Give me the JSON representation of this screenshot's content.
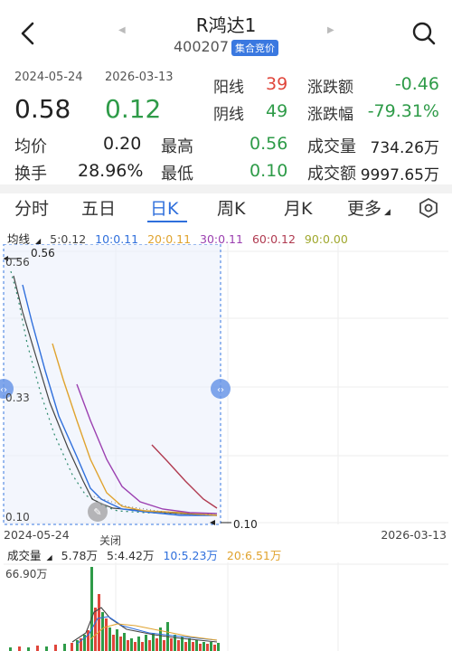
{
  "header": {
    "title": "R鸿达1",
    "code": "400207",
    "badge": "集合竞价"
  },
  "summary": {
    "start_date": "2024-05-24",
    "end_date": "2026-03-13",
    "start_price": "0.58",
    "end_price": "0.12",
    "up_days_label": "阳线",
    "up_days": "39",
    "down_days_label": "阴线",
    "down_days": "49",
    "change_amount_label": "涨跌额",
    "change_amount": "-0.46",
    "change_pct_label": "涨跌幅",
    "change_pct": "-79.31%",
    "avg_label": "均价",
    "avg": "0.20",
    "high_label": "最高",
    "high": "0.56",
    "volume_label": "成交量",
    "volume": "734.26万",
    "turnover_label": "换手",
    "turnover": "28.96%",
    "low_label": "最低",
    "low": "0.10",
    "amount_label": "成交额",
    "amount": "9997.65万"
  },
  "tabs": [
    "分时",
    "五日",
    "日K",
    "周K",
    "月K",
    "更多"
  ],
  "active_tab": "日K",
  "ma": {
    "label": "均线",
    "items": [
      {
        "text": "5:0.12",
        "color": "#444444"
      },
      {
        "text": "10:0.11",
        "color": "#2f6fdc"
      },
      {
        "text": "20:0.11",
        "color": "#e0a32e"
      },
      {
        "text": "30:0.11",
        "color": "#9b3fb0"
      },
      {
        "text": "60:0.12",
        "color": "#b03a50"
      },
      {
        "text": "90:0.00",
        "color": "#a0a82e"
      }
    ]
  },
  "chart": {
    "y_top": "0.56",
    "y_mid": "0.33",
    "y_bottom": "0.10",
    "max_label": "0.56",
    "min_label": "0.10",
    "x_start": "2024-05-24",
    "x_end": "2026-03-13",
    "close_label": "关闭"
  },
  "volume": {
    "label": "成交量",
    "items": [
      {
        "text": "5.78万",
        "color": "#333333"
      },
      {
        "text": "5:4.42万",
        "color": "#333333"
      },
      {
        "text": "10:5.23万",
        "color": "#2f6fdc"
      },
      {
        "text": "20:6.51万",
        "color": "#e0a32e"
      }
    ],
    "max_label": "66.90万"
  },
  "chart_data": {
    "type": "line",
    "y_range": [
      0.1,
      0.56
    ],
    "x_range": [
      "2024-05-24",
      "2026-03-13"
    ],
    "series": [
      {
        "name": "5",
        "color": "#444444"
      },
      {
        "name": "10",
        "color": "#2f6fdc"
      },
      {
        "name": "20",
        "color": "#e0a32e"
      },
      {
        "name": "30",
        "color": "#9b3fb0"
      },
      {
        "name": "60",
        "color": "#b03a50"
      },
      {
        "name": "90",
        "color": "#a0a82e"
      }
    ]
  }
}
